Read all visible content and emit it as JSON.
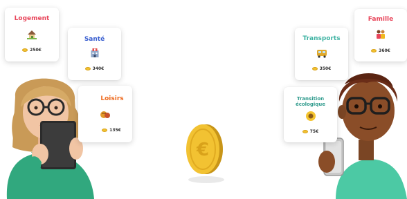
{
  "cards": {
    "logement": {
      "title": "Logement",
      "amount": "250€",
      "color": "#e8455a",
      "icon": "house-icon"
    },
    "sante": {
      "title": "Santé",
      "amount": "340€",
      "color": "#3a5fd0",
      "icon": "hospital-icon"
    },
    "loisirs": {
      "title": "Loisirs",
      "amount": "135€",
      "color": "#ee6a1e",
      "icon": "leisure-icon"
    },
    "transports": {
      "title": "Transports",
      "amount": "350€",
      "color": "#3fb3a3",
      "icon": "bus-icon"
    },
    "famille": {
      "title": "Famille",
      "amount": "360€",
      "color": "#e8455a",
      "icon": "family-icon"
    },
    "transition": {
      "title_line1": "Transition",
      "title_line2": "écologique",
      "amount": "75€",
      "color": "#2e9a8c",
      "icon": "sunflower-icon"
    }
  },
  "coin": {
    "symbol": "€",
    "color": "#f2c232"
  },
  "colors": {
    "shirt": "#31a87e",
    "card_shadow": "#d0d0d0"
  }
}
